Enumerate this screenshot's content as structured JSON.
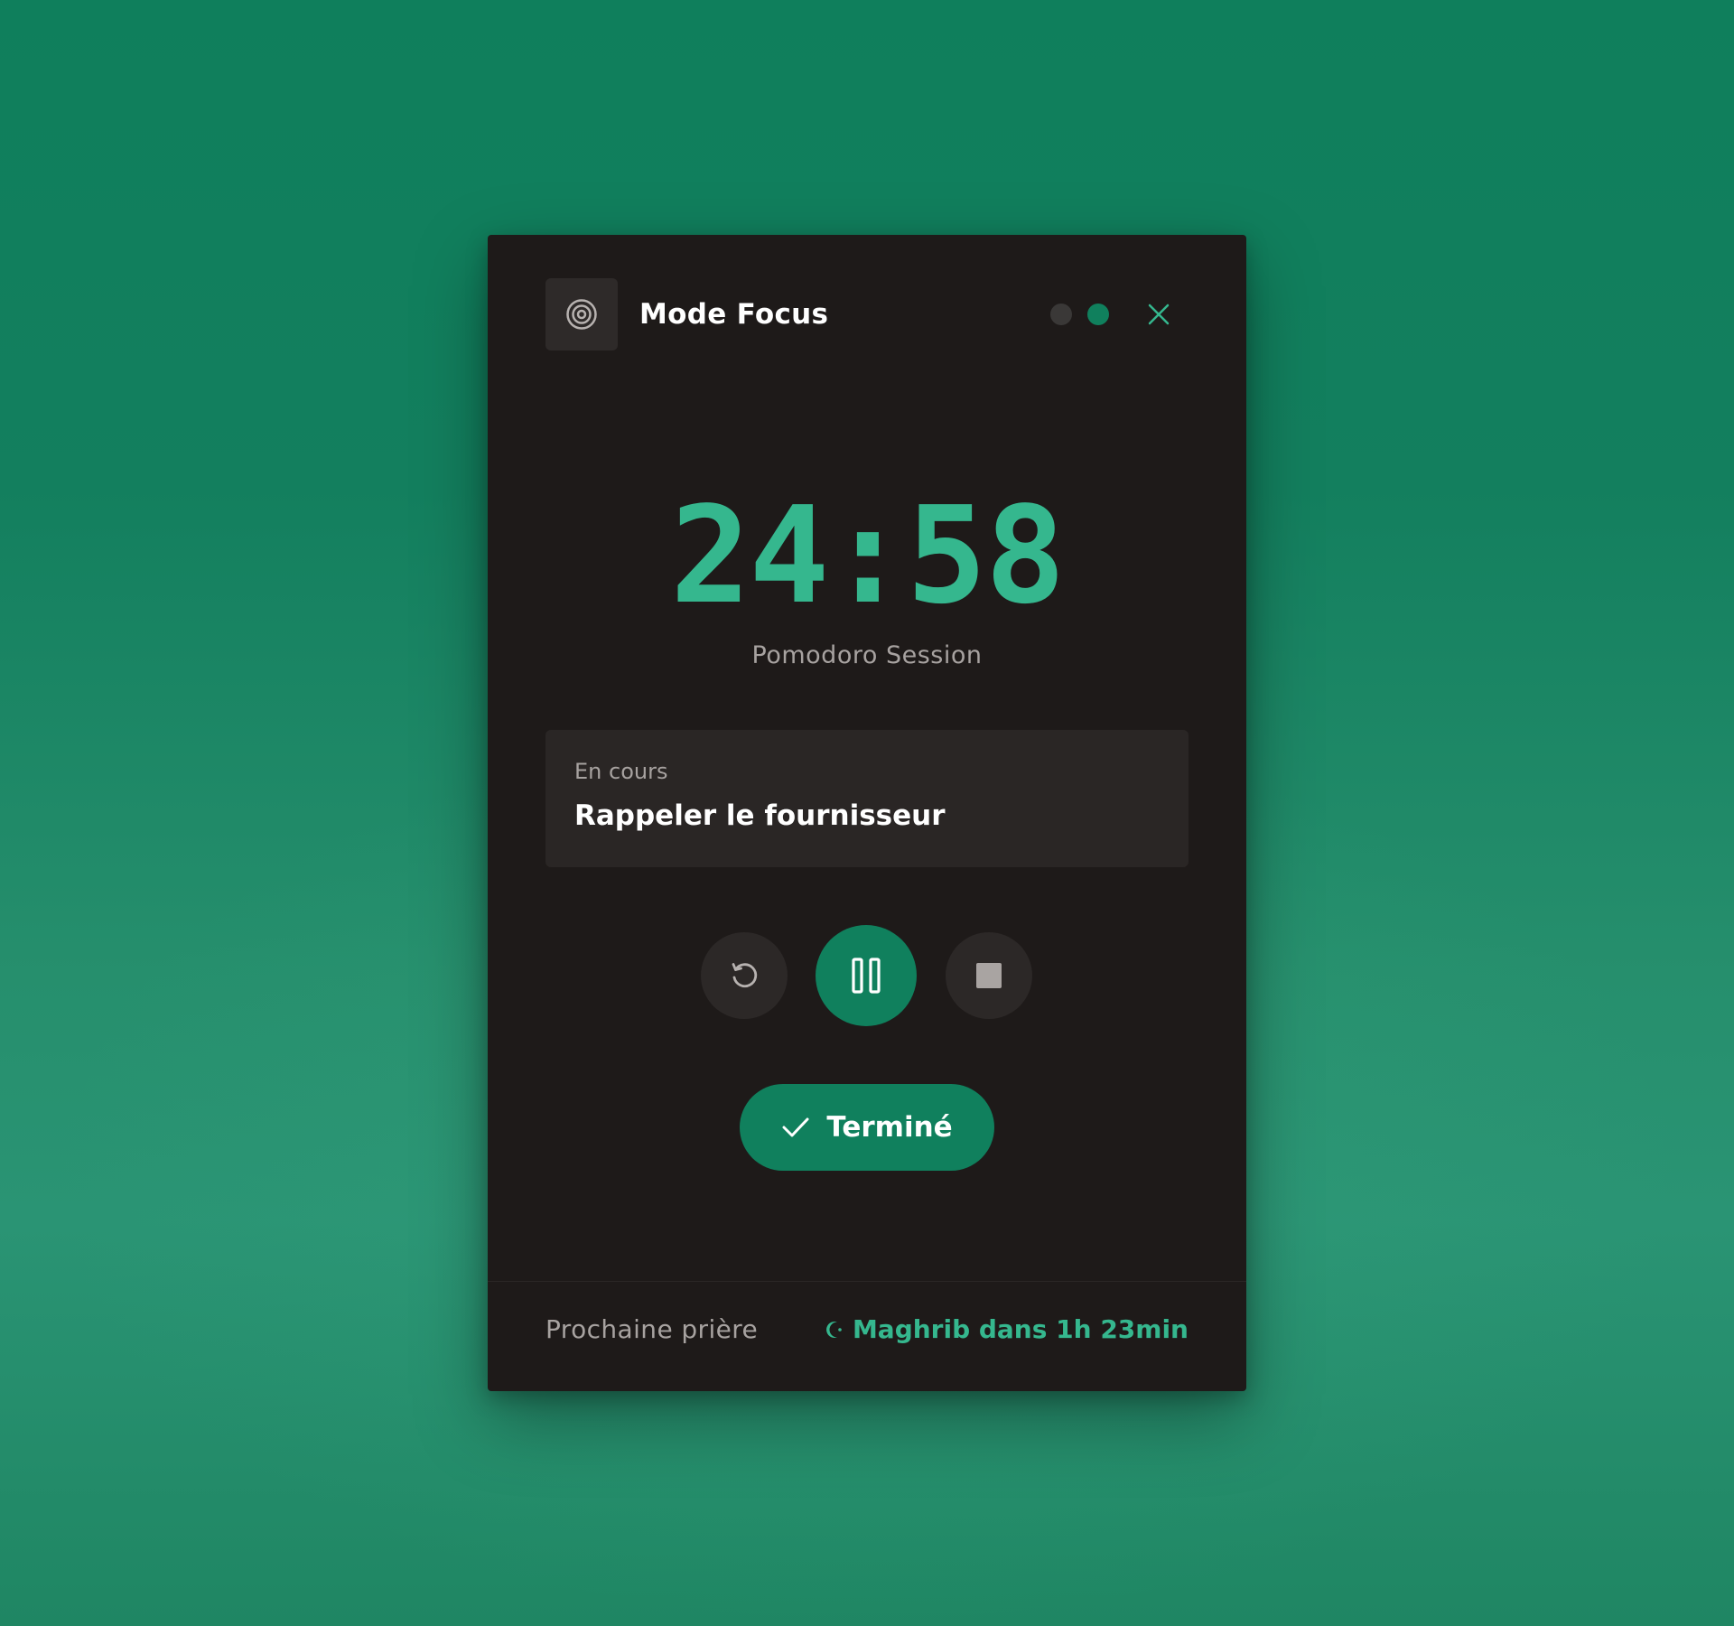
{
  "window": {
    "title": "Mode Focus",
    "app_icon": "target-icon",
    "close_icon": "close-icon"
  },
  "indicators": {
    "dots": [
      {
        "state": "inactive",
        "color": "#3a3837"
      },
      {
        "state": "active",
        "color": "#10805d"
      }
    ]
  },
  "timer": {
    "value": "24:58",
    "label": "Pomodoro Session"
  },
  "task": {
    "status": "En cours",
    "name": "Rappeler le fournisseur"
  },
  "controls": {
    "reset_icon": "reset-icon",
    "pause_icon": "pause-icon",
    "stop_icon": "stop-icon"
  },
  "done_button": {
    "label": "Terminé",
    "icon": "check-icon"
  },
  "footer": {
    "label": "Prochaine prière",
    "value": "Maghrib dans 1h 23min",
    "icon": "crescent-moon-icon"
  },
  "colors": {
    "accent": "#35b78e",
    "primary_button": "#10805d",
    "card_background": "#1e1a19",
    "page_background": "#137f5e"
  }
}
